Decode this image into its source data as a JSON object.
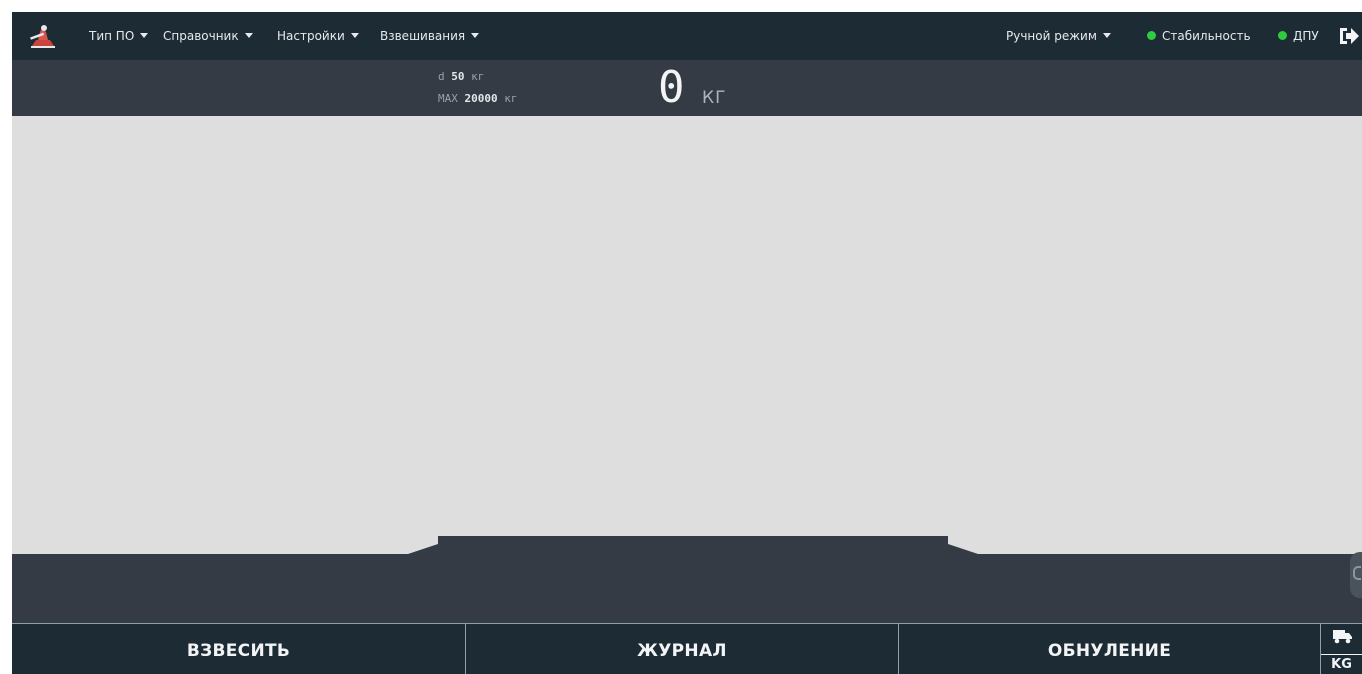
{
  "navbar": {
    "menu": [
      {
        "label": "Тип ПО"
      },
      {
        "label": "Справочник"
      },
      {
        "label": "Настройки"
      },
      {
        "label": "Взвешивания"
      }
    ],
    "mode": {
      "label": "Ручной режим"
    },
    "statuses": [
      {
        "label": "Стабильность",
        "color": "#2ecc40"
      },
      {
        "label": "ДПУ",
        "color": "#2ecc40"
      }
    ]
  },
  "scale": {
    "d_label": "d",
    "d_value": "50",
    "d_unit": "кг",
    "max_label": "MAX",
    "max_value": "20000",
    "max_unit": "кг",
    "weight": "0",
    "weight_unit": "КГ"
  },
  "actions": {
    "weigh": "ВЗВЕСИТЬ",
    "journal": "ЖУРНАЛ",
    "zero": "ОБНУЛЕНИЕ",
    "unit_toggle": "KG"
  },
  "colors": {
    "navbar_bg": "#1d2b35",
    "panel_bg": "#343b45",
    "workarea_bg": "#dedede",
    "status_green": "#2ecc40",
    "logo_red": "#d9534f"
  },
  "icons": {
    "logo": "scale-logo-icon",
    "logout": "logout-icon",
    "truck": "truck-icon"
  }
}
